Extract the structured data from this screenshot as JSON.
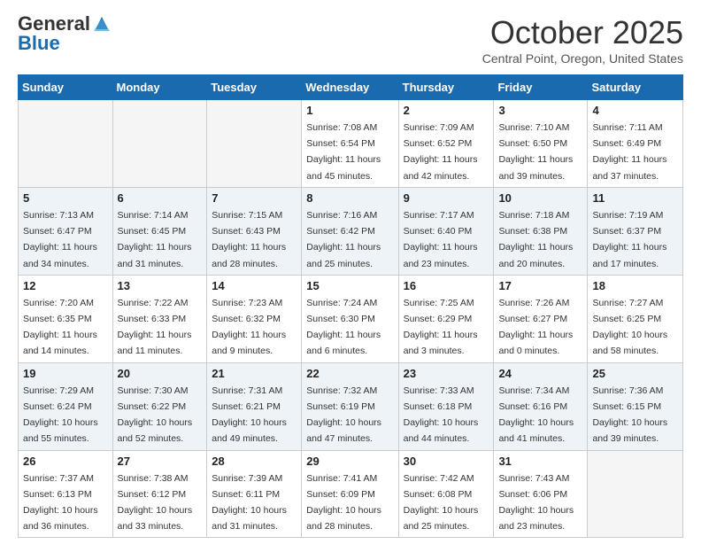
{
  "logo": {
    "general": "General",
    "blue": "Blue"
  },
  "title": "October 2025",
  "location": "Central Point, Oregon, United States",
  "weekdays": [
    "Sunday",
    "Monday",
    "Tuesday",
    "Wednesday",
    "Thursday",
    "Friday",
    "Saturday"
  ],
  "weeks": [
    [
      {
        "day": "",
        "info": ""
      },
      {
        "day": "",
        "info": ""
      },
      {
        "day": "",
        "info": ""
      },
      {
        "day": "1",
        "info": "Sunrise: 7:08 AM\nSunset: 6:54 PM\nDaylight: 11 hours and 45 minutes."
      },
      {
        "day": "2",
        "info": "Sunrise: 7:09 AM\nSunset: 6:52 PM\nDaylight: 11 hours and 42 minutes."
      },
      {
        "day": "3",
        "info": "Sunrise: 7:10 AM\nSunset: 6:50 PM\nDaylight: 11 hours and 39 minutes."
      },
      {
        "day": "4",
        "info": "Sunrise: 7:11 AM\nSunset: 6:49 PM\nDaylight: 11 hours and 37 minutes."
      }
    ],
    [
      {
        "day": "5",
        "info": "Sunrise: 7:13 AM\nSunset: 6:47 PM\nDaylight: 11 hours and 34 minutes."
      },
      {
        "day": "6",
        "info": "Sunrise: 7:14 AM\nSunset: 6:45 PM\nDaylight: 11 hours and 31 minutes."
      },
      {
        "day": "7",
        "info": "Sunrise: 7:15 AM\nSunset: 6:43 PM\nDaylight: 11 hours and 28 minutes."
      },
      {
        "day": "8",
        "info": "Sunrise: 7:16 AM\nSunset: 6:42 PM\nDaylight: 11 hours and 25 minutes."
      },
      {
        "day": "9",
        "info": "Sunrise: 7:17 AM\nSunset: 6:40 PM\nDaylight: 11 hours and 23 minutes."
      },
      {
        "day": "10",
        "info": "Sunrise: 7:18 AM\nSunset: 6:38 PM\nDaylight: 11 hours and 20 minutes."
      },
      {
        "day": "11",
        "info": "Sunrise: 7:19 AM\nSunset: 6:37 PM\nDaylight: 11 hours and 17 minutes."
      }
    ],
    [
      {
        "day": "12",
        "info": "Sunrise: 7:20 AM\nSunset: 6:35 PM\nDaylight: 11 hours and 14 minutes."
      },
      {
        "day": "13",
        "info": "Sunrise: 7:22 AM\nSunset: 6:33 PM\nDaylight: 11 hours and 11 minutes."
      },
      {
        "day": "14",
        "info": "Sunrise: 7:23 AM\nSunset: 6:32 PM\nDaylight: 11 hours and 9 minutes."
      },
      {
        "day": "15",
        "info": "Sunrise: 7:24 AM\nSunset: 6:30 PM\nDaylight: 11 hours and 6 minutes."
      },
      {
        "day": "16",
        "info": "Sunrise: 7:25 AM\nSunset: 6:29 PM\nDaylight: 11 hours and 3 minutes."
      },
      {
        "day": "17",
        "info": "Sunrise: 7:26 AM\nSunset: 6:27 PM\nDaylight: 11 hours and 0 minutes."
      },
      {
        "day": "18",
        "info": "Sunrise: 7:27 AM\nSunset: 6:25 PM\nDaylight: 10 hours and 58 minutes."
      }
    ],
    [
      {
        "day": "19",
        "info": "Sunrise: 7:29 AM\nSunset: 6:24 PM\nDaylight: 10 hours and 55 minutes."
      },
      {
        "day": "20",
        "info": "Sunrise: 7:30 AM\nSunset: 6:22 PM\nDaylight: 10 hours and 52 minutes."
      },
      {
        "day": "21",
        "info": "Sunrise: 7:31 AM\nSunset: 6:21 PM\nDaylight: 10 hours and 49 minutes."
      },
      {
        "day": "22",
        "info": "Sunrise: 7:32 AM\nSunset: 6:19 PM\nDaylight: 10 hours and 47 minutes."
      },
      {
        "day": "23",
        "info": "Sunrise: 7:33 AM\nSunset: 6:18 PM\nDaylight: 10 hours and 44 minutes."
      },
      {
        "day": "24",
        "info": "Sunrise: 7:34 AM\nSunset: 6:16 PM\nDaylight: 10 hours and 41 minutes."
      },
      {
        "day": "25",
        "info": "Sunrise: 7:36 AM\nSunset: 6:15 PM\nDaylight: 10 hours and 39 minutes."
      }
    ],
    [
      {
        "day": "26",
        "info": "Sunrise: 7:37 AM\nSunset: 6:13 PM\nDaylight: 10 hours and 36 minutes."
      },
      {
        "day": "27",
        "info": "Sunrise: 7:38 AM\nSunset: 6:12 PM\nDaylight: 10 hours and 33 minutes."
      },
      {
        "day": "28",
        "info": "Sunrise: 7:39 AM\nSunset: 6:11 PM\nDaylight: 10 hours and 31 minutes."
      },
      {
        "day": "29",
        "info": "Sunrise: 7:41 AM\nSunset: 6:09 PM\nDaylight: 10 hours and 28 minutes."
      },
      {
        "day": "30",
        "info": "Sunrise: 7:42 AM\nSunset: 6:08 PM\nDaylight: 10 hours and 25 minutes."
      },
      {
        "day": "31",
        "info": "Sunrise: 7:43 AM\nSunset: 6:06 PM\nDaylight: 10 hours and 23 minutes."
      },
      {
        "day": "",
        "info": ""
      }
    ]
  ]
}
